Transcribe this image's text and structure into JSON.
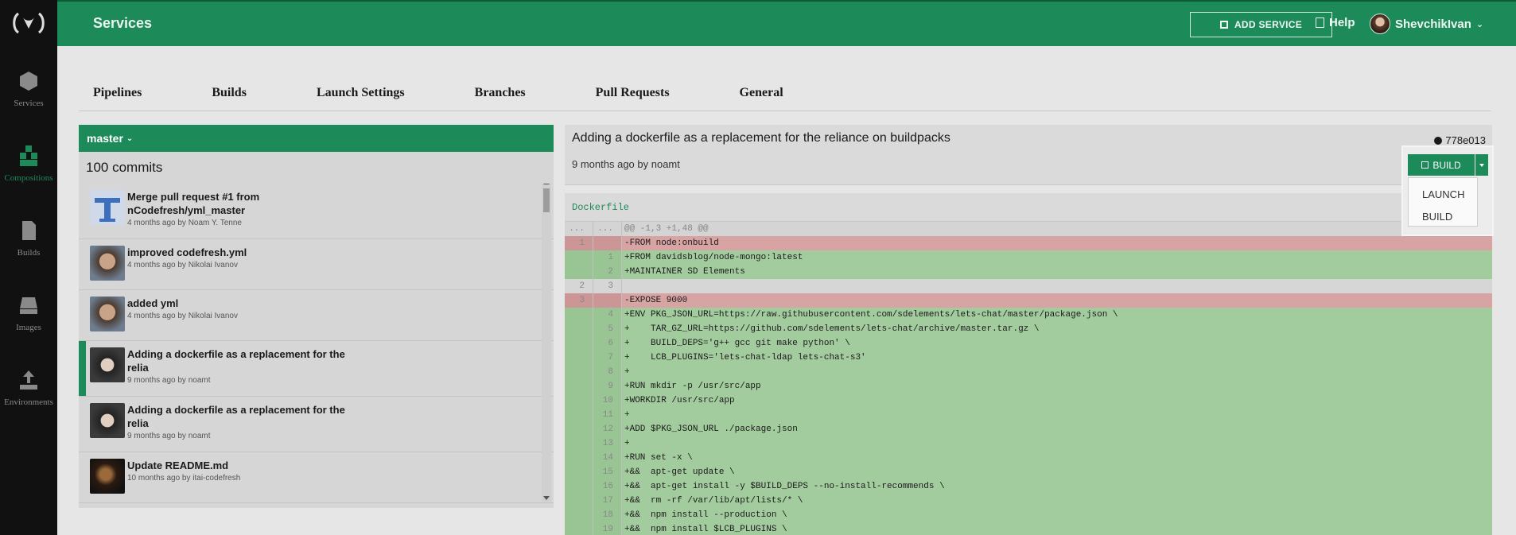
{
  "sidebar": {
    "items": [
      {
        "label": "Services",
        "icon": "cube-icon",
        "active": false
      },
      {
        "label": "Compositions",
        "icon": "cubes-icon",
        "active": true
      },
      {
        "label": "Builds",
        "icon": "document-icon",
        "active": false
      },
      {
        "label": "Images",
        "icon": "drive-icon",
        "active": false
      },
      {
        "label": "Environments",
        "icon": "upload-icon",
        "active": false
      }
    ]
  },
  "header": {
    "title": "Services",
    "add_service_label": "ADD SERVICE",
    "help_label": "Help",
    "user_name": "ShevchikIvan"
  },
  "tabs": [
    "Pipelines",
    "Builds",
    "Launch Settings",
    "Branches",
    "Pull Requests",
    "General"
  ],
  "branch": {
    "name": "master"
  },
  "commits": {
    "count_label": "100 commits",
    "items": [
      {
        "message": "Merge pull request #1 from nCodefresh/yml_master",
        "meta": "4 months ago by Noam Y. Tenne"
      },
      {
        "message": "improved codefresh.yml",
        "meta": "4 months ago by Nikolai Ivanov"
      },
      {
        "message": "added yml",
        "meta": "4 months ago by Nikolai Ivanov"
      },
      {
        "message": "Adding a dockerfile as a replacement for the relia",
        "meta": "9 months ago by noamt"
      },
      {
        "message": "Adding a dockerfile as a replacement for the relia",
        "meta": "9 months ago by noamt"
      },
      {
        "message": "Update README.md",
        "meta": "10 months ago by itai-codefresh"
      }
    ]
  },
  "detail": {
    "title": "Adding a dockerfile as a replacement for the reliance on buildpacks",
    "meta": "9 months ago by noamt",
    "sha": "778e013",
    "build_label": "BUILD",
    "menu": [
      "LAUNCH",
      "BUILD"
    ]
  },
  "diff": {
    "file": "Dockerfile",
    "rows": [
      {
        "type": "hunk",
        "old": "...",
        "new": "...",
        "code": "@@ -1,3 +1,48 @@"
      },
      {
        "type": "del",
        "old": "1",
        "new": "",
        "code": "-FROM node:onbuild"
      },
      {
        "type": "add",
        "old": "",
        "new": "1",
        "code": "+FROM davidsblog/node-mongo:latest"
      },
      {
        "type": "add",
        "old": "",
        "new": "2",
        "code": "+MAINTAINER SD Elements"
      },
      {
        "type": "ctx",
        "old": "2",
        "new": "3",
        "code": ""
      },
      {
        "type": "del",
        "old": "3",
        "new": "",
        "code": "-EXPOSE 9000"
      },
      {
        "type": "add",
        "old": "",
        "new": "4",
        "code": "+ENV PKG_JSON_URL=https://raw.githubusercontent.com/sdelements/lets-chat/master/package.json \\"
      },
      {
        "type": "add",
        "old": "",
        "new": "5",
        "code": "+    TAR_GZ_URL=https://github.com/sdelements/lets-chat/archive/master.tar.gz \\"
      },
      {
        "type": "add",
        "old": "",
        "new": "6",
        "code": "+    BUILD_DEPS='g++ gcc git make python' \\"
      },
      {
        "type": "add",
        "old": "",
        "new": "7",
        "code": "+    LCB_PLUGINS='lets-chat-ldap lets-chat-s3'"
      },
      {
        "type": "add",
        "old": "",
        "new": "8",
        "code": "+"
      },
      {
        "type": "add",
        "old": "",
        "new": "9",
        "code": "+RUN mkdir -p /usr/src/app"
      },
      {
        "type": "add",
        "old": "",
        "new": "10",
        "code": "+WORKDIR /usr/src/app"
      },
      {
        "type": "add",
        "old": "",
        "new": "11",
        "code": "+"
      },
      {
        "type": "add",
        "old": "",
        "new": "12",
        "code": "+ADD $PKG_JSON_URL ./package.json"
      },
      {
        "type": "add",
        "old": "",
        "new": "13",
        "code": "+"
      },
      {
        "type": "add",
        "old": "",
        "new": "14",
        "code": "+RUN set -x \\"
      },
      {
        "type": "add",
        "old": "",
        "new": "15",
        "code": "+&&  apt-get update \\"
      },
      {
        "type": "add",
        "old": "",
        "new": "16",
        "code": "+&&  apt-get install -y $BUILD_DEPS --no-install-recommends \\"
      },
      {
        "type": "add",
        "old": "",
        "new": "17",
        "code": "+&&  rm -rf /var/lib/apt/lists/* \\"
      },
      {
        "type": "add",
        "old": "",
        "new": "18",
        "code": "+&&  npm install --production \\"
      },
      {
        "type": "add",
        "old": "",
        "new": "19",
        "code": "+&&  npm install $LCB_PLUGINS \\"
      }
    ]
  },
  "colors": {
    "brand": "#1d8a5a",
    "diff_add": "#a3cc9e",
    "diff_del": "#d8a3a3"
  }
}
